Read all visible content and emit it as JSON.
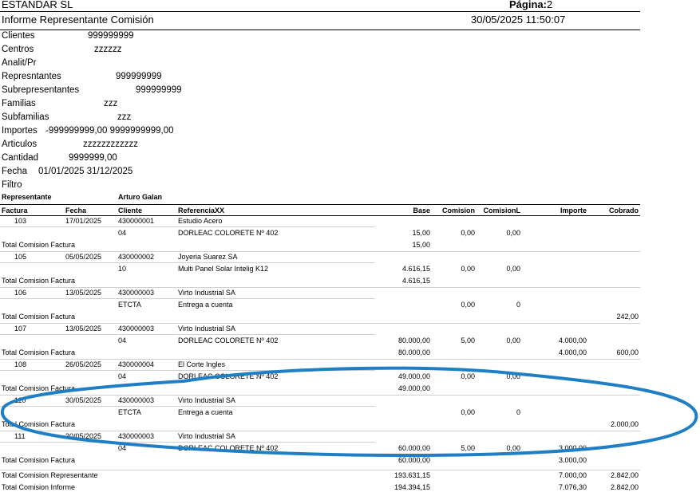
{
  "header": {
    "company": "ESTANDAR SL",
    "page_label": "Página:",
    "page_number": "2",
    "report_title": "Informe  Representante  Comisión",
    "datetime": "30/05/2025 11:50:07"
  },
  "filters": [
    {
      "label": "Clientes",
      "value": "999999999"
    },
    {
      "label": "Centros",
      "value": "zzzzzz"
    },
    {
      "label": "Analit/Pr",
      "value": ""
    },
    {
      "label": "Represntantes",
      "value": "999999999"
    },
    {
      "label": "Subrepresentantes",
      "value": "999999999"
    },
    {
      "label": "Familias",
      "value": "zzz"
    },
    {
      "label": "Subfamilias",
      "value": "zzz"
    },
    {
      "label": "Importes",
      "value": "-999999999,00  9999999999,00"
    },
    {
      "label": "Articulos",
      "value": "zzzzzzzzzzzz"
    },
    {
      "label": "Cantidad",
      "value": "9999999,00"
    },
    {
      "label": "Fecha",
      "value": "01/01/2025     31/12/2025"
    },
    {
      "label": "Filtro",
      "value": ""
    }
  ],
  "representante": {
    "label": "Representante",
    "name": "Arturo Galan"
  },
  "columns": {
    "factura": "Factura",
    "fecha": "Fecha",
    "cliente": "Cliente",
    "referencia": "ReferenciaXX",
    "base": "Base",
    "comision": "Comision",
    "comisionl": "ComisionL",
    "importe": "Importe",
    "cobrado": "Cobrado"
  },
  "invoices": [
    {
      "factura": "103",
      "fecha": "17/01/2025",
      "cliente": "430000001",
      "nombre": "Estudio Acero",
      "ref": "04",
      "desc": "DORLEAC COLORETE Nº 402",
      "base": "15,00",
      "comision": "0,00",
      "comisionl": "0,00",
      "importe": "",
      "cobrado": "",
      "total_label": "Total Comision  Factura",
      "total_base": "15,00",
      "total_importe": "",
      "total_cobrado": ""
    },
    {
      "factura": "105",
      "fecha": "05/05/2025",
      "cliente": "430000002",
      "nombre": "Joyeria Suarez SA",
      "ref": "10",
      "desc": "Multi Panel Solar Intelig K12",
      "base": "4.616,15",
      "comision": "0,00",
      "comisionl": "0,00",
      "importe": "",
      "cobrado": "",
      "total_label": "Total Comision  Factura",
      "total_base": "4.616,15",
      "total_importe": "",
      "total_cobrado": ""
    },
    {
      "factura": "106",
      "fecha": "13/05/2025",
      "cliente": "430000003",
      "nombre": "Virto Industrial SA",
      "ref": "ETCTA",
      "desc": "Entrega a cuenta",
      "base": "",
      "comision": "0,00",
      "comisionl": "0",
      "importe": "",
      "cobrado": "",
      "total_label": "Total Comision  Factura",
      "total_base": "",
      "total_importe": "",
      "total_cobrado": "242,00"
    },
    {
      "factura": "107",
      "fecha": "13/05/2025",
      "cliente": "430000003",
      "nombre": "Virto Industrial SA",
      "ref": "04",
      "desc": "DORLEAC COLORETE Nº 402",
      "base": "80.000,00",
      "comision": "5,00",
      "comisionl": "0,00",
      "importe": "4.000,00",
      "cobrado": "",
      "total_label": "Total Comision  Factura",
      "total_base": "80.000,00",
      "total_importe": "4.000,00",
      "total_cobrado": "600,00"
    },
    {
      "factura": "108",
      "fecha": "26/05/2025",
      "cliente": "430000004",
      "nombre": "El Corte Ingles",
      "ref": "04",
      "desc": "DORLEAC COLORETE Nº 402",
      "base": "49.000,00",
      "comision": "0,00",
      "comisionl": "0,00",
      "importe": "",
      "cobrado": "",
      "total_label": "Total Comision  Factura",
      "total_base": "49.000,00",
      "total_importe": "",
      "total_cobrado": ""
    },
    {
      "factura": "110",
      "fecha": "30/05/2025",
      "cliente": "430000003",
      "nombre": "Virto Industrial SA",
      "ref": "ETCTA",
      "desc": "Entrega a cuenta",
      "base": "",
      "comision": "0,00",
      "comisionl": "0",
      "importe": "",
      "cobrado": "",
      "total_label": "Total Comision  Factura",
      "total_base": "",
      "total_importe": "",
      "total_cobrado": "2.000,00"
    },
    {
      "factura": "111",
      "fecha": "30/05/2025",
      "cliente": "430000003",
      "nombre": "Virto Industrial SA",
      "ref": "04",
      "desc": "DORLEAC COLORETE Nº 402",
      "base": "60.000,00",
      "comision": "5,00",
      "comisionl": "0,00",
      "importe": "3.000,00",
      "cobrado": "",
      "total_label": "Total Comision  Factura",
      "total_base": "60.000,00",
      "total_importe": "3.000,00",
      "total_cobrado": ""
    }
  ],
  "totals": {
    "representante": {
      "label": "Total Comision Representante",
      "base": "193.631,15",
      "importe": "7.000,00",
      "cobrado": "2.842,00"
    },
    "informe": {
      "label": "Total Comision Informe",
      "base": "194.394,15",
      "importe": "7.076,30",
      "cobrado": "2.842,00"
    }
  },
  "annotation": {
    "color": "#1f7fc4"
  }
}
